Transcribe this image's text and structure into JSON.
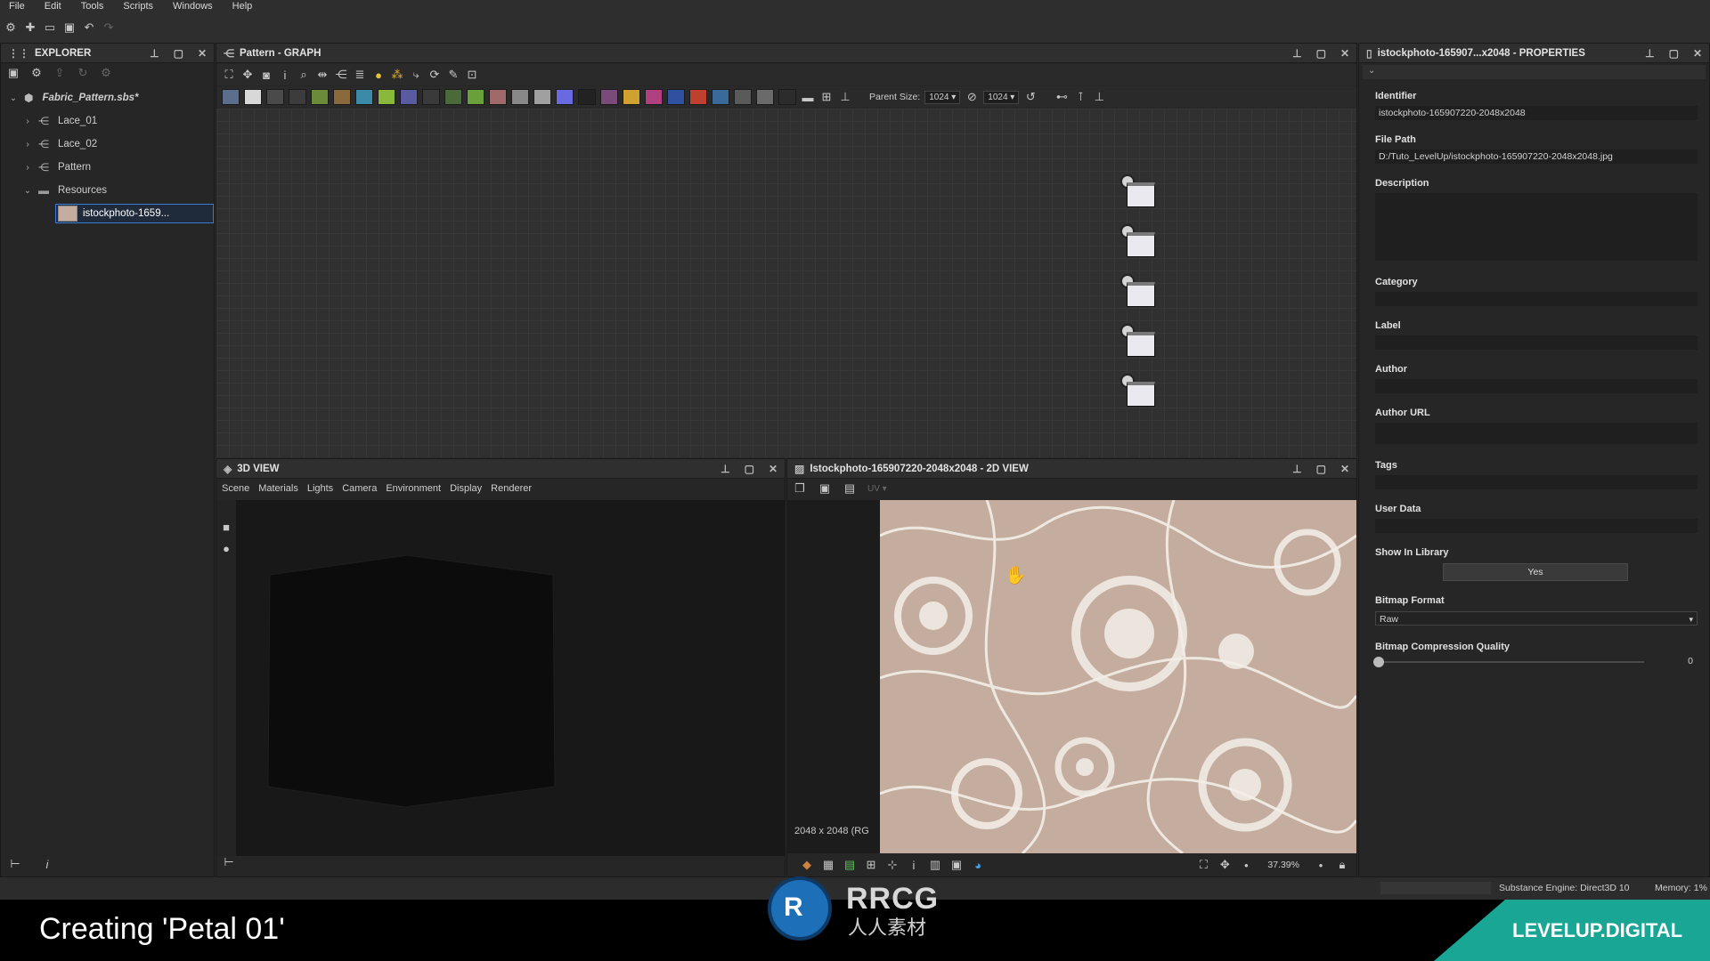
{
  "menu": [
    "File",
    "Edit",
    "Tools",
    "Scripts",
    "Windows",
    "Help"
  ],
  "explorer": {
    "title": "EXPLORER",
    "tree": [
      {
        "label": "Fabric_Pattern.sbs*",
        "level": 0
      },
      {
        "label": "Lace_01",
        "level": 1
      },
      {
        "label": "Lace_02",
        "level": 1
      },
      {
        "label": "Pattern",
        "level": 1
      },
      {
        "label": "Resources",
        "level": 1
      },
      {
        "label": "istockphoto-1659...",
        "level": 2
      }
    ]
  },
  "graph": {
    "title": "Pattern - GRAPH",
    "parent_size_label": "Parent Size:",
    "parent_size_w": "1024",
    "parent_size_h": "1024"
  },
  "view3d": {
    "title": "3D VIEW",
    "menu": [
      "Scene",
      "Materials",
      "Lights",
      "Camera",
      "Environment",
      "Display",
      "Renderer"
    ]
  },
  "view2d": {
    "title": "Istockphoto-165907220-2048x2048 - 2D VIEW",
    "uv_label": "UV",
    "resolution": "2048 x 2048 (RG",
    "zoom": "37.39%"
  },
  "properties": {
    "title": "istockphoto-165907...x2048 - PROPERTIES",
    "fields": {
      "identifier_label": "Identifier",
      "identifier_value": "istockphoto-165907220-2048x2048",
      "filepath_label": "File Path",
      "filepath_value": "D:/Tuto_LevelUp/istockphoto-165907220-2048x2048.jpg",
      "description_label": "Description",
      "category_label": "Category",
      "label_label": "Label",
      "author_label": "Author",
      "authorurl_label": "Author URL",
      "tags_label": "Tags",
      "userdata_label": "User Data",
      "showinlibrary_label": "Show In Library",
      "showinlibrary_value": "Yes",
      "bitmapformat_label": "Bitmap Format",
      "bitmapformat_value": "Raw",
      "compression_label": "Bitmap Compression Quality",
      "compression_value": "0"
    }
  },
  "status": {
    "engine": "Substance Engine: Direct3D 10",
    "memory": "Memory: 1%"
  },
  "footer": {
    "caption": "Creating 'Petal 01'",
    "logo_main": "RRCG",
    "logo_sub": "人人素材",
    "brand": "LEVELUP.DIGITAL"
  },
  "colors": {
    "lace_bg": "#c4ad9f",
    "lace_fg": "#f4efe9",
    "brand_green": "#1aa694",
    "selection": "#3a7bd5"
  }
}
